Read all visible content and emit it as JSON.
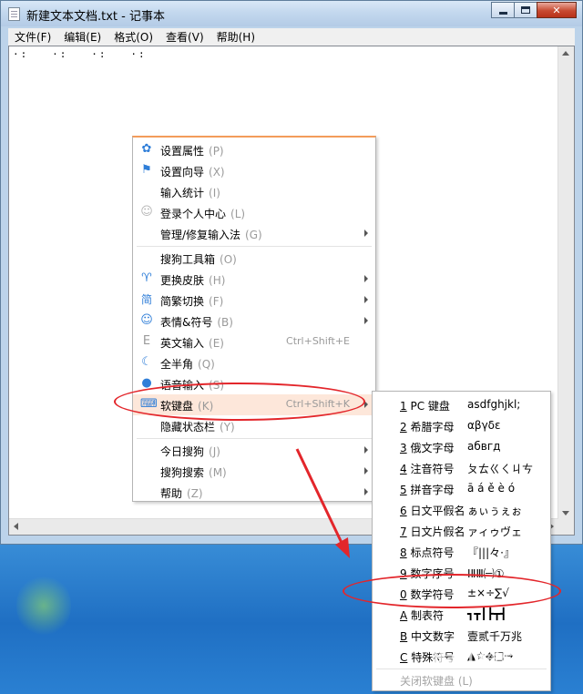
{
  "window": {
    "title": "新建文本文档.txt - 记事本",
    "menus": [
      "文件(F)",
      "编辑(E)",
      "格式(O)",
      "查看(V)",
      "帮助(H)"
    ],
    "editor_text": "·:   ·:   ·:   ·:"
  },
  "context_menu": {
    "items": [
      {
        "icon": "gear-icon",
        "label": "设置属性",
        "key": "(P)",
        "shortcut": "",
        "submenu": false
      },
      {
        "icon": "flag-icon",
        "label": "设置向导",
        "key": "(X)",
        "shortcut": "",
        "submenu": false
      },
      {
        "icon": "",
        "label": "输入统计",
        "key": "(I)",
        "shortcut": "",
        "submenu": false
      },
      {
        "icon": "user-icon",
        "label": "登录个人中心",
        "key": "(L)",
        "shortcut": "",
        "submenu": false
      },
      {
        "icon": "",
        "label": "管理/修复输入法",
        "key": "(G)",
        "shortcut": "",
        "submenu": true
      },
      {
        "icon": "",
        "label": "搜狗工具箱",
        "key": "(O)",
        "shortcut": "",
        "submenu": false
      },
      {
        "icon": "shirt-icon",
        "label": "更换皮肤",
        "key": "(H)",
        "shortcut": "",
        "submenu": true
      },
      {
        "icon": "simplified-icon",
        "label": "简繁切换",
        "key": "(F)",
        "shortcut": "",
        "submenu": true
      },
      {
        "icon": "smiley-icon",
        "label": "表情&符号",
        "key": "(B)",
        "shortcut": "",
        "submenu": true
      },
      {
        "icon": "english-icon",
        "label": "英文输入",
        "key": "(E)",
        "shortcut": "Ctrl+Shift+E",
        "submenu": false
      },
      {
        "icon": "moon-icon",
        "label": "全半角",
        "key": "(Q)",
        "shortcut": "",
        "submenu": false
      },
      {
        "icon": "mic-icon",
        "label": "语音输入",
        "key": "(S)",
        "shortcut": "",
        "submenu": false
      },
      {
        "icon": "keyboard-icon",
        "label": "软键盘",
        "key": "(K)",
        "shortcut": "Ctrl+Shift+K",
        "submenu": true
      },
      {
        "icon": "",
        "label": "隐藏状态栏",
        "key": "(Y)",
        "shortcut": "",
        "submenu": false
      },
      {
        "icon": "",
        "label": "今日搜狗",
        "key": "(J)",
        "shortcut": "",
        "submenu": true
      },
      {
        "icon": "",
        "label": "搜狗搜索",
        "key": "(M)",
        "shortcut": "",
        "submenu": true
      },
      {
        "icon": "",
        "label": "帮助",
        "key": "(Z)",
        "shortcut": "",
        "submenu": true
      }
    ]
  },
  "soft_keyboard_menu": {
    "items": [
      {
        "num": "1",
        "label": " PC 键盘",
        "sample": "asdfghjkl;"
      },
      {
        "num": "2",
        "label": " 希腊字母",
        "sample": "αβγδε"
      },
      {
        "num": "3",
        "label": " 俄文字母",
        "sample": "абвгд"
      },
      {
        "num": "4",
        "label": " 注音符号",
        "sample": "ㄆㄊㄍㄑㄐㄘ"
      },
      {
        "num": "5",
        "label": " 拼音字母",
        "sample": "ā á ě è ó"
      },
      {
        "num": "6",
        "label": " 日文平假名",
        "sample": "ぁぃぅぇぉ"
      },
      {
        "num": "7",
        "label": " 日文片假名",
        "sample": "ァィゥヴェ"
      },
      {
        "num": "8",
        "label": " 标点符号",
        "sample": "『|||々·』"
      },
      {
        "num": "9",
        "label": " 数字序号",
        "sample": "ⅠⅡⅢ㈠①"
      },
      {
        "num": "0",
        "label": " 数学符号",
        "sample": "±×÷∑√"
      },
      {
        "num": "A",
        "label": " 制表符",
        "sample": "┓┳┃┣┳┫"
      },
      {
        "num": "B",
        "label": " 中文数字",
        "sample": "壹贰千万兆"
      },
      {
        "num": "C",
        "label": " 特殊符号",
        "sample": "▲☆◆□→"
      }
    ],
    "close_label": "关闭软键盘 (L)"
  },
  "watermark": "Baidu经验"
}
